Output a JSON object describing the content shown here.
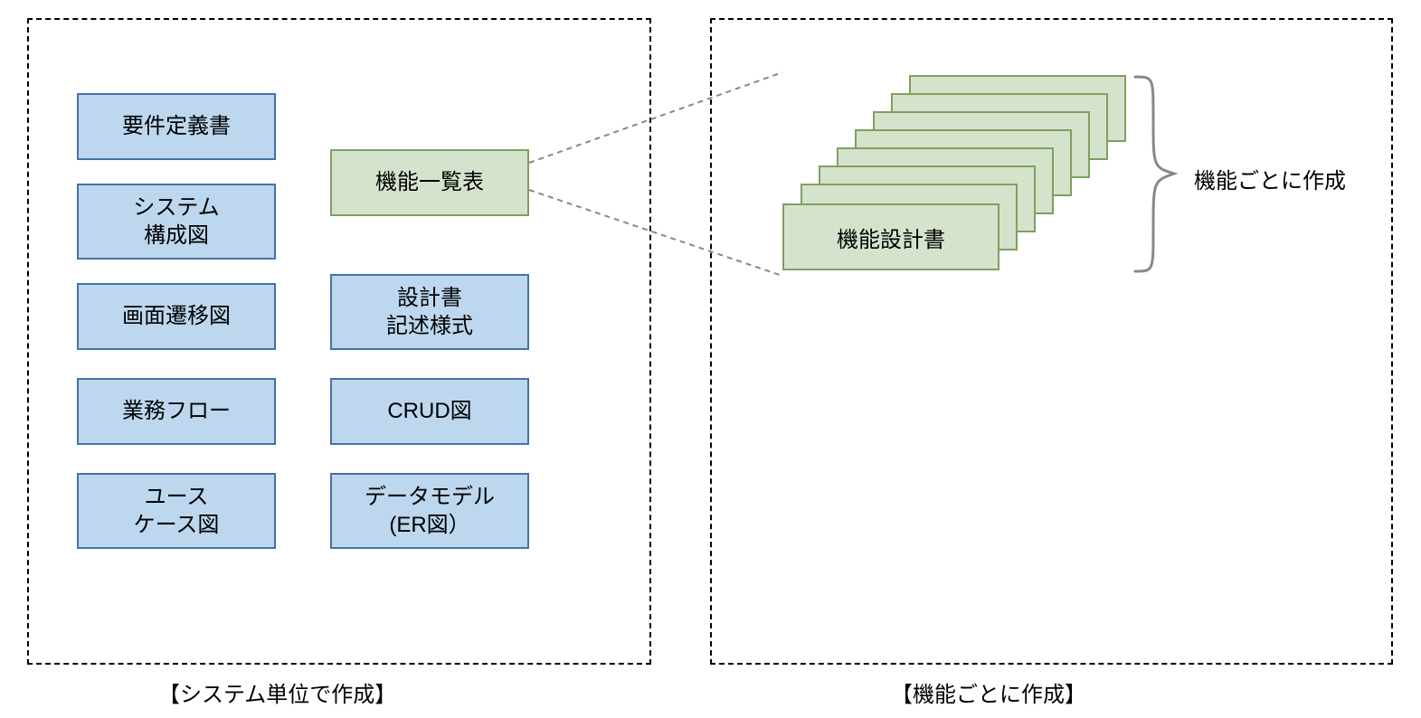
{
  "left_panel": {
    "caption": "【システム単位で作成】",
    "docs_col1": [
      "要件定義書",
      "システム\n構成図",
      "画面遷移図",
      "業務フロー",
      "ユース\nケース図"
    ],
    "docs_col2": [
      "機能一覧表",
      "設計書\n記述様式",
      "CRUD図",
      "データモデル\n(ER図）"
    ]
  },
  "right_panel": {
    "caption": "【機能ごとに作成】",
    "stack_label": "機能設計書",
    "annotation": "機能ごとに作成"
  }
}
